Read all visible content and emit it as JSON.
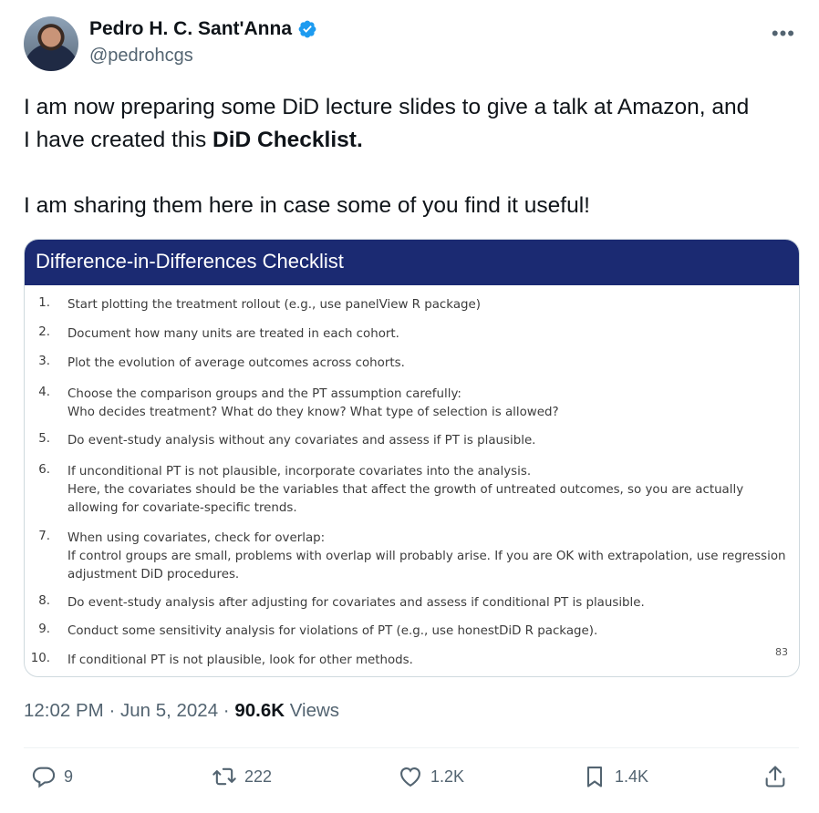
{
  "author": {
    "display_name": "Pedro H. C. Sant'Anna",
    "handle": "@pedrohcgs"
  },
  "tweet": {
    "line1": "I am now preparing some DiD lecture slides to give a talk at Amazon, and",
    "line2_prefix": "I have created this ",
    "line2_bold": "DiD Checklist.",
    "line3": "I am sharing them here in case some of you find it useful!"
  },
  "slide": {
    "title": "Difference-in-Differences Checklist",
    "page_number": "83",
    "items": [
      {
        "num": "1.",
        "lines": [
          "Start plotting the treatment rollout (e.g., use panelView R package)"
        ]
      },
      {
        "num": "2.",
        "lines": [
          "Document how many units are treated in each cohort."
        ]
      },
      {
        "num": "3.",
        "lines": [
          "Plot the evolution of average outcomes across cohorts."
        ]
      },
      {
        "num": "4.",
        "lines": [
          "Choose the comparison groups and the PT assumption carefully:",
          "Who decides treatment? What do they know? What type of selection is allowed?"
        ]
      },
      {
        "num": "5.",
        "lines": [
          "Do event-study analysis without any covariates and assess if PT is plausible."
        ]
      },
      {
        "num": "6.",
        "lines": [
          "If unconditional PT is not plausible, incorporate covariates into the analysis.",
          "Here, the covariates should be the variables that affect the growth of untreated outcomes, so you are actually",
          "allowing for covariate-specific trends."
        ]
      },
      {
        "num": "7.",
        "lines": [
          "When using covariates, check for overlap:",
          "If control groups are small, problems with overlap will probably arise.  If you are OK with extrapolation, use regression",
          "adjustment DiD procedures."
        ]
      },
      {
        "num": "8.",
        "lines": [
          "Do event-study analysis after adjusting for covariates and assess if conditional PT is plausible."
        ]
      },
      {
        "num": "9.",
        "lines": [
          "Conduct some sensitivity analysis for violations of PT (e.g., use honestDiD R package)."
        ]
      },
      {
        "num": "10.",
        "lines": [
          "If conditional PT is not plausible, look for other methods."
        ]
      }
    ]
  },
  "meta": {
    "time_date": "12:02 PM · Jun 5, 2024 · ",
    "views_count": "90.6K",
    "views_label": " Views"
  },
  "actions": {
    "replies": "9",
    "reposts": "222",
    "likes": "1.2K",
    "bookmarks": "1.4K"
  },
  "colors": {
    "verified_blue": "#1d9bf0",
    "slide_header": "#1b2a72",
    "secondary_text": "#536471"
  }
}
